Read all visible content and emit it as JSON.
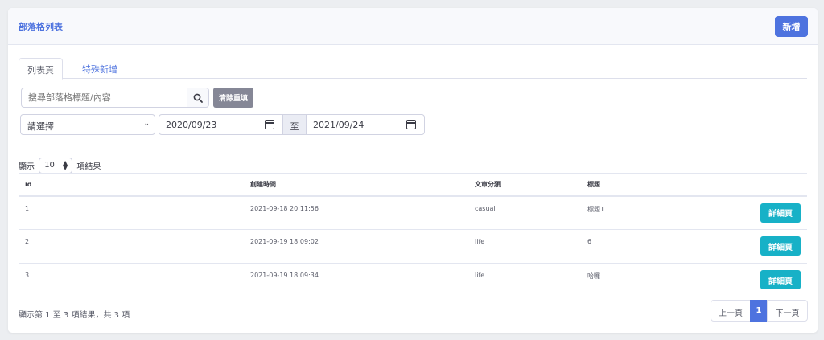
{
  "header": {
    "title": "部落格列表",
    "add_label": "新增"
  },
  "tabs": [
    {
      "label": "列表頁"
    },
    {
      "label": "特殊新增"
    }
  ],
  "search": {
    "placeholder": "搜尋部落格標題/內容",
    "clear_label": "清除重填"
  },
  "filters": {
    "category": "請選擇",
    "date_from": "2020/09/23",
    "to_label": "至",
    "date_to": "2021/09/24"
  },
  "length": {
    "prefix": "顯示",
    "value": "10",
    "suffix": "項結果"
  },
  "table": {
    "columns": [
      "id",
      "創建時間",
      "文章分類",
      "標題",
      ""
    ],
    "rows": [
      {
        "id": "1",
        "created": "2021-09-18 20:11:56",
        "category": "casual",
        "title": "標題1",
        "action": "詳細頁"
      },
      {
        "id": "2",
        "created": "2021-09-19 18:09:02",
        "category": "life",
        "title": "6",
        "action": "詳細頁"
      },
      {
        "id": "3",
        "created": "2021-09-19 18:09:34",
        "category": "life",
        "title": "哈囉",
        "action": "詳細頁"
      }
    ]
  },
  "footer": {
    "info": "顯示第 1 至 3 項結果，共 3 項"
  },
  "pagination": {
    "prev": "上一頁",
    "current": "1",
    "next": "下一頁"
  },
  "colors": {
    "primary": "#4e73df",
    "info": "#17b1c7",
    "secondary": "#858796"
  }
}
